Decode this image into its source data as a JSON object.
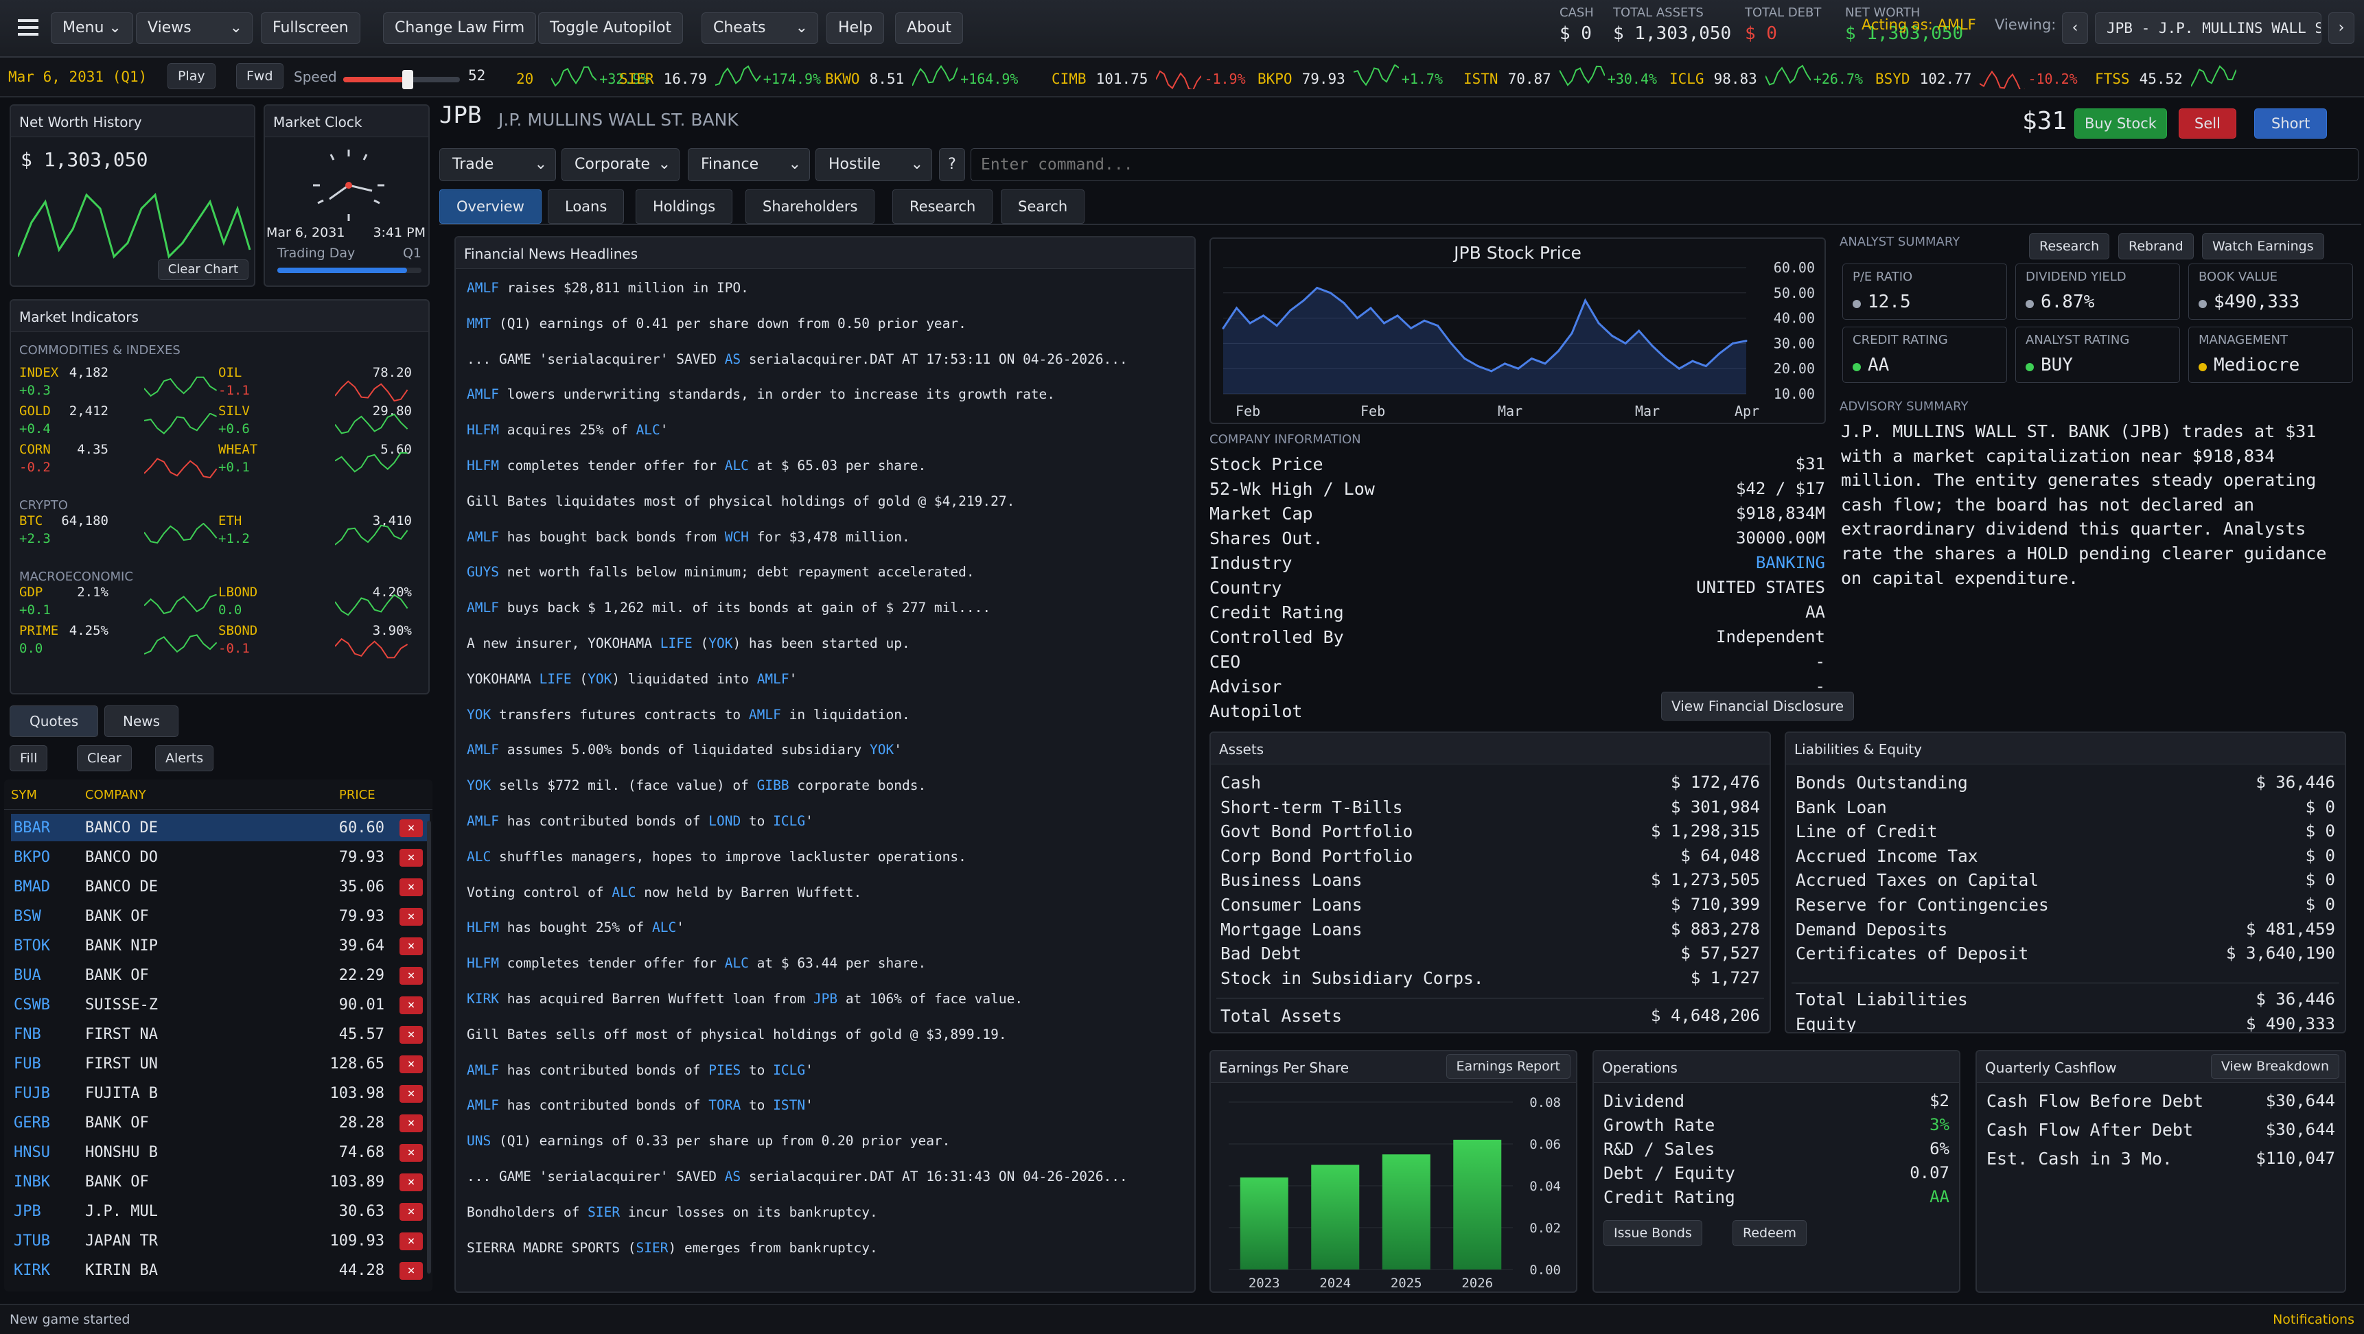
{
  "menu": {
    "menu": "Menu",
    "views": "Views",
    "fullscreen": "Fullscreen",
    "change_firm": "Change Law Firm",
    "autopilot": "Toggle Autopilot",
    "cheats": "Cheats",
    "help": "Help",
    "about": "About"
  },
  "header": {
    "cash_label": "CASH",
    "cash": "$ 0",
    "assets_label": "TOTAL ASSETS",
    "assets": "$ 1,303,050",
    "debt_label": "TOTAL DEBT",
    "debt": "$ 0",
    "nw_label": "NET WORTH",
    "nw": "$ 1,303,050",
    "acting": "Acting as: AMLF",
    "viewing_label": "Viewing:",
    "viewing": "JPB - J.P. MULLINS WALL ST"
  },
  "ticker": {
    "date": "Mar 6, 2031 (Q1)",
    "play": "Play",
    "fwd": "Fwd",
    "speed": "Speed",
    "speed_val": "52",
    "speed_pct": 0.55,
    "items": [
      {
        "sym": "20",
        "price": "",
        "chg": "+32.9%",
        "up": true
      },
      {
        "sym": "SIER",
        "price": "16.79",
        "chg": "+174.9%",
        "up": true
      },
      {
        "sym": "BKWO",
        "price": "8.51",
        "chg": "+164.9%",
        "up": true
      },
      {
        "sym": "CIMB",
        "price": "101.75",
        "chg": "-1.9%",
        "up": false
      },
      {
        "sym": "BKPO",
        "price": "79.93",
        "chg": "+1.7%",
        "up": true
      },
      {
        "sym": "ISTN",
        "price": "70.87",
        "chg": "+30.4%",
        "up": true
      },
      {
        "sym": "ICLG",
        "price": "98.83",
        "chg": "+26.7%",
        "up": true
      },
      {
        "sym": "BSYD",
        "price": "102.77",
        "chg": "-10.2%",
        "up": false
      },
      {
        "sym": "FTSS",
        "price": "45.52",
        "chg": "",
        "up": true
      }
    ]
  },
  "nw_history": {
    "title": "Net Worth History",
    "value": "$ 1,303,050",
    "clear": "Clear Chart"
  },
  "clock": {
    "title": "Market Clock",
    "date": "Mar 6, 2031",
    "time": "3:41 PM",
    "day_label": "Trading Day",
    "quarter": "Q1",
    "progress": 0.9
  },
  "indicators": {
    "title": "Market Indicators",
    "sec1": "COMMODITIES & INDEXES",
    "sec2": "CRYPTO",
    "sec3": "MACROECONOMIC",
    "items": [
      {
        "name": "INDEX",
        "val": "4,182",
        "chg": "+0.3",
        "up": true
      },
      {
        "name": "OIL",
        "val": "78.20",
        "chg": "-1.1",
        "up": false
      },
      {
        "name": "GOLD",
        "val": "2,412",
        "chg": "+0.4",
        "up": true
      },
      {
        "name": "SILV",
        "val": "29.80",
        "chg": "+0.6",
        "up": true
      },
      {
        "name": "CORN",
        "val": "4.35",
        "chg": "-0.2",
        "up": false
      },
      {
        "name": "WHEAT",
        "val": "5.60",
        "chg": "+0.1",
        "up": true
      },
      {
        "name": "BTC",
        "val": "64,180",
        "chg": "+2.3",
        "up": true
      },
      {
        "name": "ETH",
        "val": "3,410",
        "chg": "+1.2",
        "up": true
      },
      {
        "name": "GDP",
        "val": "2.1%",
        "chg": "+0.1",
        "up": true
      },
      {
        "name": "LBOND",
        "val": "4.20%",
        "chg": "0.0",
        "up": true
      },
      {
        "name": "PRIME",
        "val": "4.25%",
        "chg": "0.0",
        "up": true
      },
      {
        "name": "SBOND",
        "val": "3.90%",
        "chg": "-0.1",
        "up": false
      }
    ]
  },
  "quotes": {
    "tab1": "Quotes",
    "tab2": "News",
    "fill": "Fill",
    "clear": "Clear",
    "alerts": "Alerts",
    "h_sym": "SYM",
    "h_co": "COMPANY",
    "h_price": "PRICE",
    "rows": [
      {
        "s": "BBAR",
        "c": "BANCO DE",
        "p": "60.60"
      },
      {
        "s": "BKPO",
        "c": "BANCO DO",
        "p": "79.93"
      },
      {
        "s": "BMAD",
        "c": "BANCO DE",
        "p": "35.06"
      },
      {
        "s": "BSW",
        "c": "BANK OF",
        "p": "79.93"
      },
      {
        "s": "BTOK",
        "c": "BANK NIP",
        "p": "39.64"
      },
      {
        "s": "BUA",
        "c": "BANK OF",
        "p": "22.29"
      },
      {
        "s": "CSWB",
        "c": "SUISSE-Z",
        "p": "90.01"
      },
      {
        "s": "FNB",
        "c": "FIRST NA",
        "p": "45.57"
      },
      {
        "s": "FUB",
        "c": "FIRST UN",
        "p": "128.65"
      },
      {
        "s": "FUJB",
        "c": "FUJITA B",
        "p": "103.98"
      },
      {
        "s": "GERB",
        "c": "BANK OF",
        "p": "28.28"
      },
      {
        "s": "HNSU",
        "c": "HONSHU B",
        "p": "74.68"
      },
      {
        "s": "INBK",
        "c": "BANK OF",
        "p": "103.89"
      },
      {
        "s": "JPB",
        "c": "J.P. MUL",
        "p": "30.63"
      },
      {
        "s": "JTUB",
        "c": "JAPAN TR",
        "p": "109.93"
      },
      {
        "s": "KIRK",
        "c": "KIRIN BA",
        "p": "44.28"
      }
    ]
  },
  "company": {
    "sym": "JPB",
    "name": "J.P. MULLINS WALL ST. BANK",
    "price": "$31",
    "buy": "Buy Stock",
    "sell": "Sell",
    "short": "Short",
    "dd": [
      "Trade",
      "Corporate",
      "Finance",
      "Hostile"
    ],
    "help": "?",
    "cmd_placeholder": "Enter command...",
    "tabs": [
      "Overview",
      "Loans",
      "Holdings",
      "Shareholders",
      "Research",
      "Search"
    ]
  },
  "news": {
    "title": "Financial News Headlines",
    "items": [
      [
        {
          "t": "AMLF",
          "l": true
        },
        {
          "t": " raises $28,811 million in IPO."
        }
      ],
      [
        {
          "t": "MMT",
          "l": true
        },
        {
          "t": " (Q1) earnings of 0.41 per share down from 0.50 prior year."
        }
      ],
      [
        {
          "t": "... GAME 'serialacquirer' SAVED "
        },
        {
          "t": "AS",
          "l": true
        },
        {
          "t": " serialacquirer.DAT AT 17:53:11 ON 04-26-2026..."
        }
      ],
      [
        {
          "t": "AMLF",
          "l": true
        },
        {
          "t": " lowers underwriting standards, in order to increase its growth rate."
        }
      ],
      [
        {
          "t": "HLFM",
          "l": true
        },
        {
          "t": " acquires 25% of "
        },
        {
          "t": "ALC",
          "l": true
        },
        {
          "t": "'"
        }
      ],
      [
        {
          "t": "HLFM",
          "l": true
        },
        {
          "t": " completes tender offer for "
        },
        {
          "t": "ALC",
          "l": true
        },
        {
          "t": " at $ 65.03 per share."
        }
      ],
      [
        {
          "t": "Gill Bates liquidates most of physical holdings of gold @ $4,219.27."
        }
      ],
      [
        {
          "t": "AMLF",
          "l": true
        },
        {
          "t": " has bought back bonds from "
        },
        {
          "t": "WCH",
          "l": true
        },
        {
          "t": " for $3,478 million."
        }
      ],
      [
        {
          "t": "GUYS",
          "l": true
        },
        {
          "t": " net worth falls below minimum; debt repayment accelerated."
        }
      ],
      [
        {
          "t": "AMLF",
          "l": true
        },
        {
          "t": " buys back $ 1,262 mil. of its bonds at gain of $ 277 mil...."
        }
      ],
      [
        {
          "t": "A new insurer, YOKOHAMA "
        },
        {
          "t": "LIFE",
          "l": true
        },
        {
          "t": " ("
        },
        {
          "t": "YOK",
          "l": true
        },
        {
          "t": ") has been started up."
        }
      ],
      [
        {
          "t": "YOKOHAMA "
        },
        {
          "t": "LIFE",
          "l": true
        },
        {
          "t": " ("
        },
        {
          "t": "YOK",
          "l": true
        },
        {
          "t": ") liquidated into "
        },
        {
          "t": "AMLF",
          "l": true
        },
        {
          "t": "'"
        }
      ],
      [
        {
          "t": "YOK",
          "l": true
        },
        {
          "t": " transfers futures contracts to "
        },
        {
          "t": "AMLF",
          "l": true
        },
        {
          "t": " in liquidation."
        }
      ],
      [
        {
          "t": "AMLF",
          "l": true
        },
        {
          "t": " assumes 5.00% bonds of liquidated subsidiary "
        },
        {
          "t": "YOK",
          "l": true
        },
        {
          "t": "'"
        }
      ],
      [
        {
          "t": "YOK",
          "l": true
        },
        {
          "t": " sells $772 mil. (face value) of "
        },
        {
          "t": "GIBB",
          "l": true
        },
        {
          "t": " corporate bonds."
        }
      ],
      [
        {
          "t": "AMLF",
          "l": true
        },
        {
          "t": " has contributed bonds of "
        },
        {
          "t": "LOND",
          "l": true
        },
        {
          "t": " to "
        },
        {
          "t": "ICLG",
          "l": true
        },
        {
          "t": "'"
        }
      ],
      [
        {
          "t": "ALC",
          "l": true
        },
        {
          "t": " shuffles managers, hopes to improve lackluster operations."
        }
      ],
      [
        {
          "t": "Voting control of "
        },
        {
          "t": "ALC",
          "l": true
        },
        {
          "t": " now held by Barren Wuffett."
        }
      ],
      [
        {
          "t": "HLFM",
          "l": true
        },
        {
          "t": " has bought 25% of "
        },
        {
          "t": "ALC",
          "l": true
        },
        {
          "t": "'"
        }
      ],
      [
        {
          "t": "HLFM",
          "l": true
        },
        {
          "t": " completes tender offer for "
        },
        {
          "t": "ALC",
          "l": true
        },
        {
          "t": " at $ 63.44 per share."
        }
      ],
      [
        {
          "t": "KIRK",
          "l": true
        },
        {
          "t": " has acquired Barren Wuffett loan from "
        },
        {
          "t": "JPB",
          "l": true
        },
        {
          "t": " at 106% of face value."
        }
      ],
      [
        {
          "t": "Gill Bates sells off most of physical holdings of gold @ $3,899.19."
        }
      ],
      [
        {
          "t": "AMLF",
          "l": true
        },
        {
          "t": " has contributed bonds of "
        },
        {
          "t": "PIES",
          "l": true
        },
        {
          "t": " to "
        },
        {
          "t": "ICLG",
          "l": true
        },
        {
          "t": "'"
        }
      ],
      [
        {
          "t": "AMLF",
          "l": true
        },
        {
          "t": " has contributed bonds of "
        },
        {
          "t": "TORA",
          "l": true
        },
        {
          "t": " to "
        },
        {
          "t": "ISTN",
          "l": true
        },
        {
          "t": "'"
        }
      ],
      [
        {
          "t": "UNS",
          "l": true
        },
        {
          "t": " (Q1) earnings of 0.33 per share up from 0.20 prior year."
        }
      ],
      [
        {
          "t": "... GAME 'serialacquirer' SAVED "
        },
        {
          "t": "AS",
          "l": true
        },
        {
          "t": " serialacquirer.DAT AT 16:31:43 ON 04-26-2026..."
        }
      ],
      [
        {
          "t": "Bondholders of "
        },
        {
          "t": "SIER",
          "l": true
        },
        {
          "t": " incur losses on its bankruptcy."
        }
      ],
      [
        {
          "t": "SIERRA MADRE SPORTS ("
        },
        {
          "t": "SIER",
          "l": true
        },
        {
          "t": ") emerges from bankruptcy."
        }
      ]
    ]
  },
  "stock_chart": {
    "title": "JPB Stock Price",
    "yticks": [
      "60.00",
      "50.00",
      "40.00",
      "30.00",
      "20.00",
      "10.00"
    ],
    "xticks": [
      "Feb",
      "Feb",
      "Mar",
      "Mar",
      "Apr"
    ]
  },
  "chart_data": {
    "type": "line",
    "title": "JPB Stock Price",
    "ylim": [
      10,
      60
    ],
    "x": [
      0,
      1,
      2,
      3,
      4,
      5,
      6,
      7,
      8,
      9,
      10,
      11,
      12,
      13,
      14,
      15,
      16,
      17,
      18,
      19,
      20,
      21,
      22,
      23,
      24,
      25,
      26,
      27,
      28,
      29,
      30,
      31,
      32,
      33,
      34,
      35,
      36,
      37,
      38,
      39
    ],
    "values": [
      36,
      44,
      38,
      41,
      37,
      43,
      47,
      52,
      50,
      46,
      40,
      44,
      38,
      41,
      36,
      39,
      37,
      30,
      24,
      21,
      19,
      22,
      20,
      24,
      22,
      27,
      34,
      47,
      38,
      33,
      30,
      35,
      29,
      24,
      20,
      23,
      21,
      26,
      30,
      31
    ]
  },
  "company_info": {
    "title": "COMPANY INFORMATION",
    "rows": [
      {
        "k": "Stock Price",
        "v": "$31"
      },
      {
        "k": "52-Wk High / Low",
        "v": "$42 / $17"
      },
      {
        "k": "Market Cap",
        "v": "$918,834M"
      },
      {
        "k": "Shares Out.",
        "v": "30000.00M"
      },
      {
        "k": "Industry",
        "v": "BANKING"
      },
      {
        "k": "Country",
        "v": "UNITED STATES"
      },
      {
        "k": "Credit Rating",
        "v": "AA"
      },
      {
        "k": "Controlled By",
        "v": "Independent"
      },
      {
        "k": "CEO",
        "v": "-"
      },
      {
        "k": "Advisor",
        "v": "-"
      },
      {
        "k": "Autopilot",
        "v": ""
      }
    ],
    "disclosure": "View Financial Disclosure"
  },
  "analyst": {
    "title": "ANALYST SUMMARY",
    "research": "Research",
    "rebrand": "Rebrand",
    "watch": "Watch Earnings",
    "cards": [
      {
        "k": "P/E RATIO",
        "v": "12.5",
        "c": "#9aa2b0"
      },
      {
        "k": "DIVIDEND YIELD",
        "v": "6.87%",
        "c": "#9aa2b0"
      },
      {
        "k": "BOOK VALUE",
        "v": "$490,333",
        "c": "#9aa2b0"
      },
      {
        "k": "CREDIT RATING",
        "v": "AA",
        "c": "#3ecf55"
      },
      {
        "k": "ANALYST RATING",
        "v": "BUY",
        "c": "#3ecf55"
      },
      {
        "k": "MANAGEMENT",
        "v": "Mediocre",
        "c": "#e6b800"
      }
    ],
    "advisory_title": "ADVISORY SUMMARY",
    "advisory": [
      "J.P. MULLINS WALL ST. BANK (JPB) trades at $31",
      "with a market capitalization near $918,834",
      "million. The entity generates steady operating",
      "cash flow; the board has not declared an",
      "extraordinary dividend this quarter. Analysts",
      "rate the shares a HOLD pending clearer guidance",
      "on capital expenditure."
    ]
  },
  "assets": {
    "title": "Assets",
    "rows": [
      {
        "k": "Cash",
        "v": "$ 172,476"
      },
      {
        "k": "Short-term T-Bills",
        "v": "$ 301,984"
      },
      {
        "k": "Govt Bond Portfolio",
        "v": "$ 1,298,315"
      },
      {
        "k": "Corp Bond Portfolio",
        "v": "$ 64,048"
      },
      {
        "k": "Business Loans",
        "v": "$ 1,273,505"
      },
      {
        "k": "Consumer Loans",
        "v": "$ 710,399"
      },
      {
        "k": "Mortgage Loans",
        "v": "$ 883,278"
      },
      {
        "k": "Bad Debt",
        "v": "$ 57,527"
      },
      {
        "k": "Stock in Subsidiary Corps.",
        "v": "$ 1,727"
      }
    ],
    "total_k": "Total Assets",
    "total_v": "$ 4,648,206"
  },
  "liabilities": {
    "title": "Liabilities & Equity",
    "rows": [
      {
        "k": "Bonds Outstanding",
        "v": "$ 36,446"
      },
      {
        "k": "Bank Loan",
        "v": "$ 0"
      },
      {
        "k": "Line of Credit",
        "v": "$ 0"
      },
      {
        "k": "Accrued Income Tax",
        "v": "$ 0"
      },
      {
        "k": "Accrued Taxes on Capital",
        "v": "$ 0"
      },
      {
        "k": "Reserve for Contingencies",
        "v": "$ 0"
      },
      {
        "k": "Demand Deposits",
        "v": "$ 481,459"
      },
      {
        "k": "Certificates of Deposit",
        "v": "$ 3,640,190"
      }
    ],
    "total_k": "Total Liabilities",
    "total_v": "$ 36,446",
    "eq_k": "Equity",
    "eq_v": "$ 490,333"
  },
  "eps": {
    "title": "Earnings Per Share",
    "report": "Earnings Report",
    "categories": [
      "2023",
      "2024",
      "2025",
      "2026"
    ],
    "values": [
      0.044,
      0.05,
      0.055,
      0.062
    ],
    "yticks": [
      "0.08",
      "0.06",
      "0.04",
      "0.02",
      "0.00"
    ]
  },
  "ops": {
    "title": "Operations",
    "rows": [
      {
        "k": "Dividend",
        "v": "$2",
        "c": "#e4e7ec"
      },
      {
        "k": "Growth Rate",
        "v": "3%",
        "c": "#3ecf55"
      },
      {
        "k": "R&D / Sales",
        "v": "6%",
        "c": "#e4e7ec"
      },
      {
        "k": "Debt / Equity",
        "v": "0.07",
        "c": "#e4e7ec"
      },
      {
        "k": "Credit Rating",
        "v": "AA",
        "c": "#3ecf55"
      }
    ],
    "issue": "Issue Bonds",
    "redeem": "Redeem"
  },
  "cashflow": {
    "title": "Quarterly Cashflow",
    "breakdown": "View Breakdown",
    "rows": [
      {
        "k": "Cash Flow Before Debt",
        "v": "$30,644"
      },
      {
        "k": "Cash Flow After Debt",
        "v": "$30,644"
      },
      {
        "k": "Est. Cash in 3 Mo.",
        "v": "$110,047"
      }
    ]
  },
  "status": {
    "left": "New game started",
    "right": "Notifications"
  }
}
